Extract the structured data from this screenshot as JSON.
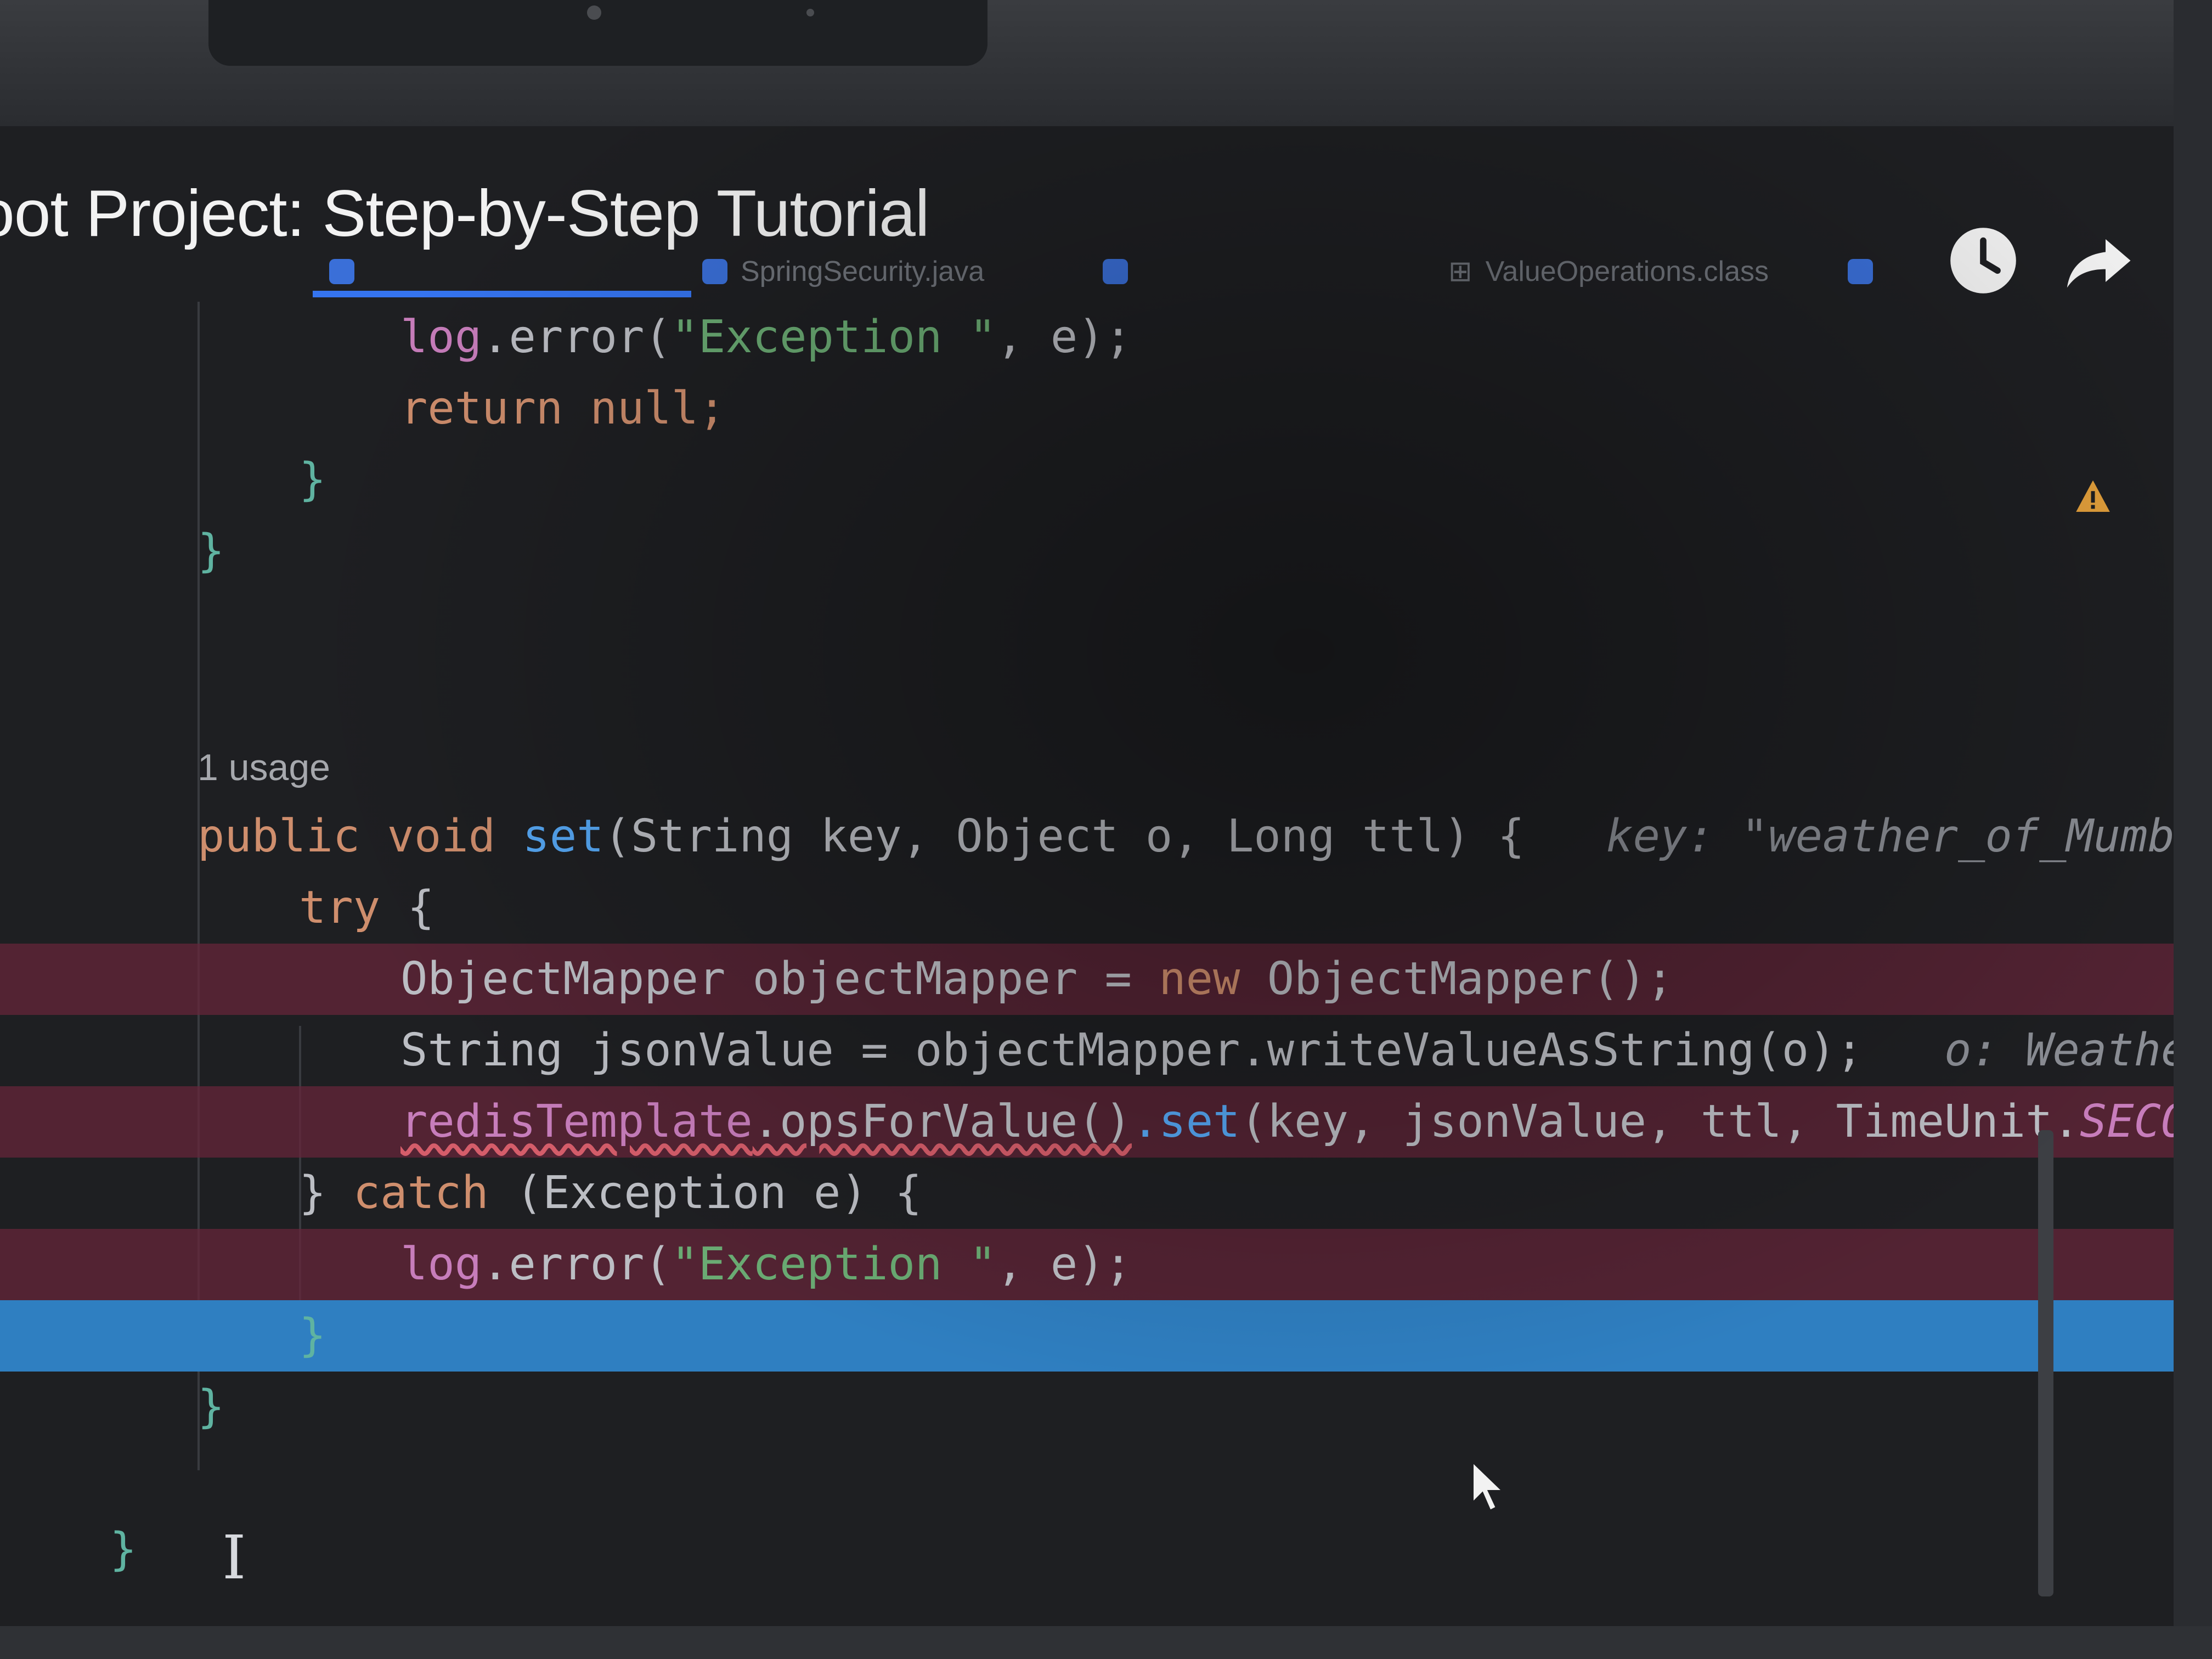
{
  "video": {
    "title": "oot Project: Step-by-Step Tutorial"
  },
  "tabs": [
    {
      "label": "",
      "active": true
    },
    {
      "label": "SpringSecurity.java",
      "active": false
    },
    {
      "label": "",
      "active": false
    },
    {
      "label": "ValueOperations.class",
      "active": false
    }
  ],
  "code": {
    "l1": {
      "obj": "log",
      "call": ".error(",
      "str": "\"Exception \"",
      "rest": ", e);"
    },
    "l2": {
      "kw": "return",
      "rest": " null;"
    },
    "l3": {
      "brace": "}"
    },
    "l4": {
      "brace": "}"
    },
    "usage": "1 usage",
    "sig": {
      "kw1": "public",
      "kw2": "void",
      "name": "set",
      "params": "(String key, Object o, Long ttl) {",
      "hint": "key: \"weather_of_Mumbai\""
    },
    "try_line": {
      "kw": "try",
      "rest": " {"
    },
    "om_line": {
      "t": "ObjectMapper objectMapper = ",
      "kw": "new",
      "rest": " ObjectMapper();"
    },
    "json_line": {
      "t": "String jsonValue = objectMapper.writeValueAsString(o);",
      "hint": "o: WeatherRe"
    },
    "redis_line": {
      "obj": "redisTemplate",
      "chain": ".opsForValue()",
      "call": ".set",
      "args": "(key, jsonValue, ttl, TimeUnit.",
      "cst": "SECONDS"
    },
    "catch_line": {
      "brace": "}",
      "kw": " catch",
      "rest": " (Exception e) {"
    },
    "log_line": {
      "obj": "log",
      "call": ".error(",
      "str": "\"Exception \"",
      "rest": ", e);"
    },
    "close1": "}",
    "close2": "}",
    "close3": "}"
  },
  "colors": {
    "editor_bg": "#1e1f22",
    "keyword": "#cf8e6d",
    "method": "#56a8f5",
    "string": "#6aab73",
    "field": "#c77dbb",
    "error_line": "#66263a",
    "execution_line": "#2f7fc1"
  },
  "icons": [
    "watch-later-icon",
    "share-icon",
    "java-class-icon",
    "warning-icon",
    "mouse-pointer-icon",
    "text-cursor-icon"
  ]
}
